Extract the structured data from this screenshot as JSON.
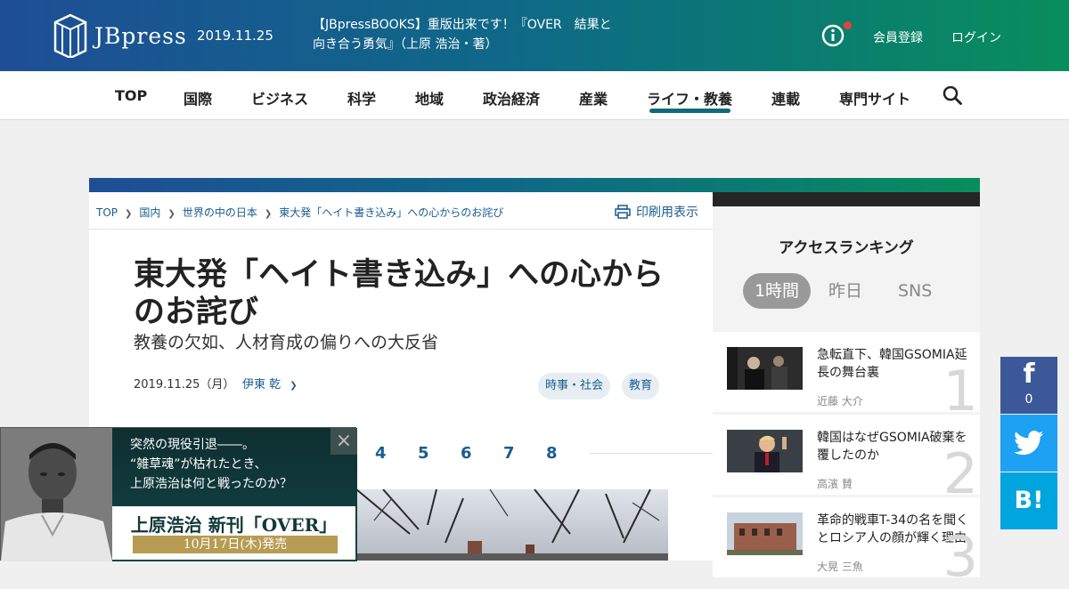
{
  "header": {
    "logo_text": "JBpress",
    "date": "2019.11.25",
    "news_line1": "【JBpressBOOKS】重版出来です！『OVER　結果と",
    "news_line2": "向き合う勇気』（上原 浩治・著）",
    "register": "会員登録",
    "login": "ログイン",
    "gradient_start": "#1e4e96",
    "gradient_end": "#088e5c"
  },
  "nav": {
    "items": [
      "TOP",
      "国際",
      "ビジネス",
      "科学",
      "地域",
      "政治経済",
      "産業",
      "ライフ・教養",
      "連載",
      "専門サイト"
    ],
    "active_index": 7
  },
  "breadcrumb": [
    "TOP",
    "国内",
    "世界の中の日本",
    "東大発「ヘイト書き込み」への心からのお詫び"
  ],
  "print_label": "印刷用表示",
  "article": {
    "title": "東大発「ヘイト書き込み」への心からのお詫び",
    "subtitle": "教養の欠如、人材育成の偏りへの大反省",
    "date": "2019.11.25（月）",
    "author": "伊東 乾",
    "tags": [
      "時事・社会",
      "教育"
    ],
    "pages": [
      "4",
      "5",
      "6",
      "7",
      "8"
    ]
  },
  "sidebar": {
    "title": "アクセスランキング",
    "tabs": [
      "1時間",
      "昨日",
      "SNS"
    ],
    "active_tab": 0,
    "ranking": [
      {
        "rank": "1",
        "title": "急転直下、韓国GSOMIA延長の舞台裏",
        "author": "近藤 大介"
      },
      {
        "rank": "2",
        "title": "韓国はなぜGSOMIA破棄を覆したのか",
        "author": "高濱 賛"
      },
      {
        "rank": "3",
        "title": "革命的戦車T-34の名を聞くとロシア人の顔が輝く理由",
        "author": "大晃 三魚"
      }
    ]
  },
  "share": {
    "facebook_count": "0",
    "facebook_icon": "f",
    "hatena_icon": "B!"
  },
  "ad": {
    "copy": "突然の現役引退――。\n“雑草魂”が枯れたとき、\n上原浩治は何と戦ったのか？",
    "book": "上原浩治 新刊「OVER」",
    "release": "10月17日(木)発売",
    "close": "×"
  }
}
